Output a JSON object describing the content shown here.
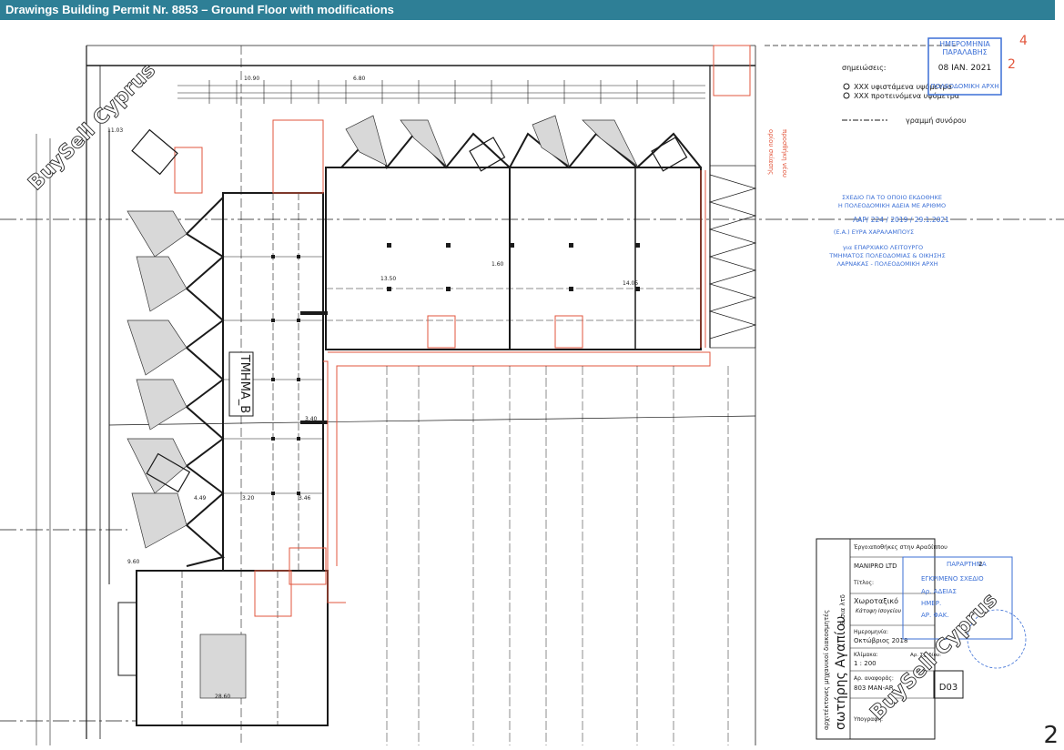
{
  "header": {
    "title": "Drawings Building Permit Nr. 8853 – Ground Floor with modifications"
  },
  "colors": {
    "header_bg": "#2e7f96",
    "line_black": "#1a1a1a",
    "line_red": "#e2563c",
    "stamp_blue": "#3b6fd6",
    "watermark": "#ffffff"
  },
  "watermark": {
    "text": "BuySell Cyprus"
  },
  "legend": {
    "title": "σημειώσεις:",
    "items": [
      "XXX υφιστάμενα υψόμετρα",
      "XXX προτεινόμενα υψόμετρα",
      "γραμμή συνόρου"
    ]
  },
  "stamp_date": {
    "line1": "ΗΜΕΡΟΜΗΝΙΑ",
    "line2": "ΠΑΡΑΛΑΒΗΣ",
    "date": "08 ΙΑΝ. 2021",
    "office": "ΠΟΛΕΟΔΟΜΙΚΗ ΑΡΧΗ",
    "hand_1": "4",
    "hand_2": "2"
  },
  "stamp_approval": {
    "lines": [
      "ΣΧΕΔΙΟ ΓΙΑ ΤΟ ΟΠΟΙΟ ΕΚΔΟΘΗΚΕ",
      "Η ΠΟΛΕΟΔΟΜΙΚΗ ΑΔΕΙΑ ΜΕ ΑΡΙΘΜΟ",
      "ΛΑΡ/ 224 / 2019 / 29.1.2021",
      "(Ε.Α.) ΕΥΡΑ ΧΑΡΑΛΑΜΠΟΥΣ",
      "για ΕΠΑΡΧΙΑΚΟ ΛΕΙΤΟΥΡΓΟ",
      "ΤΜΗΜΑΤΟΣ ΠΟΛΕΟΔΟΜΙΑΣ & ΟΙΚΗΣΗΣ",
      "ΛΑΡΝΑΚΑΣ - ΠΟΛΕΟΔΟΜΙΚΗ ΑΡΧΗ"
    ]
  },
  "section_label": "ΤΜΗΜΑ_B",
  "dimensions": [
    "13.50",
    "14.05",
    "3.40",
    "3.20",
    "3.46",
    "4.49",
    "28.60",
    "6.80",
    "10.90",
    "11.03",
    "9.60",
    "1.60"
  ],
  "title_block": {
    "architect_vertical": "αρχιτέκτονες μηχανικοί διακοσμητές",
    "firm": "σωτήρης Αγαπίου",
    "firm_suffix": "& σια λτδ",
    "project_label": "Έργο:",
    "project": "αποθήκες στην Αραδίππου",
    "client": "MANIPRO LTD",
    "title_label": "Τίτλος:",
    "drawing_title": "Χωροταξικό",
    "drawing_subtitle": "Κάτοψη Ισογείου",
    "date_label": "Ημερομηνία:",
    "date": "Οκτώβριος 2018",
    "scale_label": "Κλίμακα:",
    "scale": "1 : 200",
    "drawing_no_label": "Αρ. Σχεδίου:",
    "drawing_no": "D03",
    "reference_label": "Αρ. αναφοράς:",
    "reference": "803 MAN-AR",
    "revision": "2",
    "stamp_lines": [
      "ΠΑΡΑΡΤΗΜΑ",
      "ΕΓΚΡΙΜΕΝΟ ΣΧΕΔΙΟ",
      "Αρ. ΑΔΕΙΑΣ",
      "ΗΜΕΡ.",
      "ΑΡ. ΦΑΚ."
    ],
    "signature_label": "Υπογραφή:"
  },
  "page_number": "2"
}
